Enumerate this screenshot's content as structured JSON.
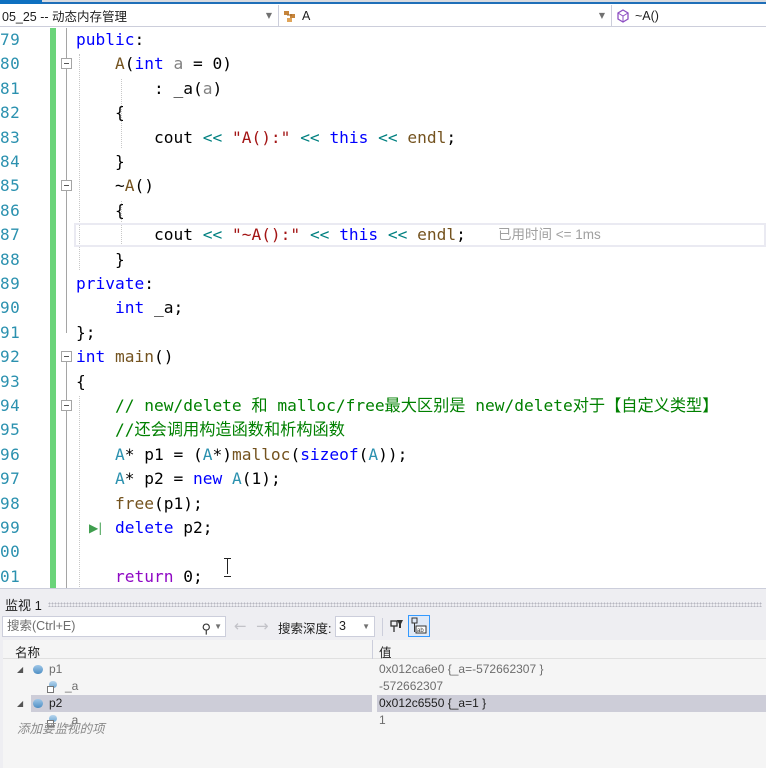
{
  "navbar": {
    "project": "05_25 -- 动态内存管理",
    "class_scope": "A",
    "member_scope": "~A()"
  },
  "editor": {
    "lines": [
      {
        "num": "79",
        "tokens": [
          {
            "t": "public",
            "c": "kw"
          },
          {
            "t": ":",
            "c": ""
          }
        ]
      },
      {
        "num": "80",
        "tokens": [
          {
            "t": "    ",
            "c": ""
          },
          {
            "t": "A",
            "c": "fn"
          },
          {
            "t": "(",
            "c": ""
          },
          {
            "t": "int",
            "c": "kw"
          },
          {
            "t": " ",
            "c": ""
          },
          {
            "t": "a",
            "c": "param"
          },
          {
            "t": " = 0)",
            "c": ""
          }
        ]
      },
      {
        "num": "81",
        "tokens": [
          {
            "t": "        : _a(",
            "c": ""
          },
          {
            "t": "a",
            "c": "param"
          },
          {
            "t": ")",
            "c": ""
          }
        ]
      },
      {
        "num": "82",
        "tokens": [
          {
            "t": "    {",
            "c": ""
          }
        ]
      },
      {
        "num": "83",
        "tokens": [
          {
            "t": "        cout ",
            "c": ""
          },
          {
            "t": "<<",
            "c": "op"
          },
          {
            "t": " ",
            "c": ""
          },
          {
            "t": "\"A():\"",
            "c": "str"
          },
          {
            "t": " ",
            "c": ""
          },
          {
            "t": "<<",
            "c": "op"
          },
          {
            "t": " ",
            "c": ""
          },
          {
            "t": "this",
            "c": "kw"
          },
          {
            "t": " ",
            "c": ""
          },
          {
            "t": "<<",
            "c": "op"
          },
          {
            "t": " ",
            "c": ""
          },
          {
            "t": "endl",
            "c": "fn"
          },
          {
            "t": ";",
            "c": ""
          }
        ]
      },
      {
        "num": "84",
        "tokens": [
          {
            "t": "    }",
            "c": ""
          }
        ]
      },
      {
        "num": "85",
        "tokens": [
          {
            "t": "    ~",
            "c": ""
          },
          {
            "t": "A",
            "c": "fn"
          },
          {
            "t": "()",
            "c": ""
          }
        ]
      },
      {
        "num": "86",
        "tokens": [
          {
            "t": "    {",
            "c": ""
          }
        ]
      },
      {
        "num": "87",
        "tokens": [
          {
            "t": "        cout ",
            "c": ""
          },
          {
            "t": "<<",
            "c": "op"
          },
          {
            "t": " ",
            "c": ""
          },
          {
            "t": "\"~A():\"",
            "c": "str"
          },
          {
            "t": " ",
            "c": ""
          },
          {
            "t": "<<",
            "c": "op"
          },
          {
            "t": " ",
            "c": ""
          },
          {
            "t": "this",
            "c": "kw"
          },
          {
            "t": " ",
            "c": ""
          },
          {
            "t": "<<",
            "c": "op"
          },
          {
            "t": " ",
            "c": ""
          },
          {
            "t": "endl",
            "c": "fn"
          },
          {
            "t": ";",
            "c": ""
          }
        ]
      },
      {
        "num": "88",
        "tokens": [
          {
            "t": "    }",
            "c": ""
          }
        ]
      },
      {
        "num": "89",
        "tokens": [
          {
            "t": "private",
            "c": "kw"
          },
          {
            "t": ":",
            "c": ""
          }
        ]
      },
      {
        "num": "90",
        "tokens": [
          {
            "t": "    ",
            "c": ""
          },
          {
            "t": "int",
            "c": "kw"
          },
          {
            "t": " _a;",
            "c": ""
          }
        ]
      },
      {
        "num": "91",
        "tokens": [
          {
            "t": "};",
            "c": ""
          }
        ]
      },
      {
        "num": "92",
        "tokens": [
          {
            "t": "int",
            "c": "kw"
          },
          {
            "t": " ",
            "c": ""
          },
          {
            "t": "main",
            "c": "fn"
          },
          {
            "t": "()",
            "c": ""
          }
        ]
      },
      {
        "num": "93",
        "tokens": [
          {
            "t": "{",
            "c": ""
          }
        ]
      },
      {
        "num": "94",
        "tokens": [
          {
            "t": "    // new/delete 和 malloc/free最大区别是 new/delete对于【自定义类型】",
            "c": "cm"
          }
        ]
      },
      {
        "num": "95",
        "tokens": [
          {
            "t": "    //还会调用构造函数和析构函数",
            "c": "cm"
          }
        ]
      },
      {
        "num": "96",
        "tokens": [
          {
            "t": "    ",
            "c": ""
          },
          {
            "t": "A",
            "c": "cls"
          },
          {
            "t": "* p1 = (",
            "c": ""
          },
          {
            "t": "A",
            "c": "cls"
          },
          {
            "t": "*)",
            "c": ""
          },
          {
            "t": "malloc",
            "c": "fn"
          },
          {
            "t": "(",
            "c": ""
          },
          {
            "t": "sizeof",
            "c": "kw"
          },
          {
            "t": "(",
            "c": ""
          },
          {
            "t": "A",
            "c": "cls"
          },
          {
            "t": "));",
            "c": ""
          }
        ]
      },
      {
        "num": "97",
        "tokens": [
          {
            "t": "    ",
            "c": ""
          },
          {
            "t": "A",
            "c": "cls"
          },
          {
            "t": "* p2 = ",
            "c": ""
          },
          {
            "t": "new",
            "c": "kw"
          },
          {
            "t": " ",
            "c": ""
          },
          {
            "t": "A",
            "c": "cls"
          },
          {
            "t": "(1);",
            "c": ""
          }
        ]
      },
      {
        "num": "98",
        "tokens": [
          {
            "t": "    ",
            "c": ""
          },
          {
            "t": "free",
            "c": "fn"
          },
          {
            "t": "(p1);",
            "c": ""
          }
        ]
      },
      {
        "num": "99",
        "tokens": [
          {
            "t": "    ",
            "c": ""
          },
          {
            "t": "delete",
            "c": "kw"
          },
          {
            "t": " p2;",
            "c": ""
          }
        ]
      },
      {
        "num": "00",
        "tokens": []
      },
      {
        "num": "01",
        "tokens": [
          {
            "t": "    ",
            "c": ""
          },
          {
            "t": "return",
            "c": "ctrl"
          },
          {
            "t": " 0;",
            "c": ""
          }
        ]
      }
    ],
    "perf_tip": "已用时间 <= 1ms"
  },
  "watch": {
    "title": "监视 1",
    "search_placeholder": "搜索(Ctrl+E)",
    "search_depth_label": "搜索深度:",
    "search_depth_value": "3",
    "columns": {
      "name": "名称",
      "value": "值"
    },
    "rows": [
      {
        "name": "p1",
        "value": "0x012ca6e0 {_a=-572662307 }",
        "level": 0,
        "expanded": true,
        "selected": false
      },
      {
        "name": "_a",
        "value": "-572662307",
        "level": 1,
        "expanded": false,
        "selected": false
      },
      {
        "name": "p2",
        "value": "0x012c6550 {_a=1 }",
        "level": 0,
        "expanded": true,
        "selected": true
      },
      {
        "name": "_a",
        "value": "1",
        "level": 1,
        "expanded": false,
        "selected": false
      }
    ],
    "add_item_hint": "添加要监视的项"
  },
  "icons": {
    "class_icon": "class-icon",
    "method_icon": "method-icon",
    "search": "search-icon",
    "back": "←",
    "forward": "→",
    "hex": "ab"
  }
}
